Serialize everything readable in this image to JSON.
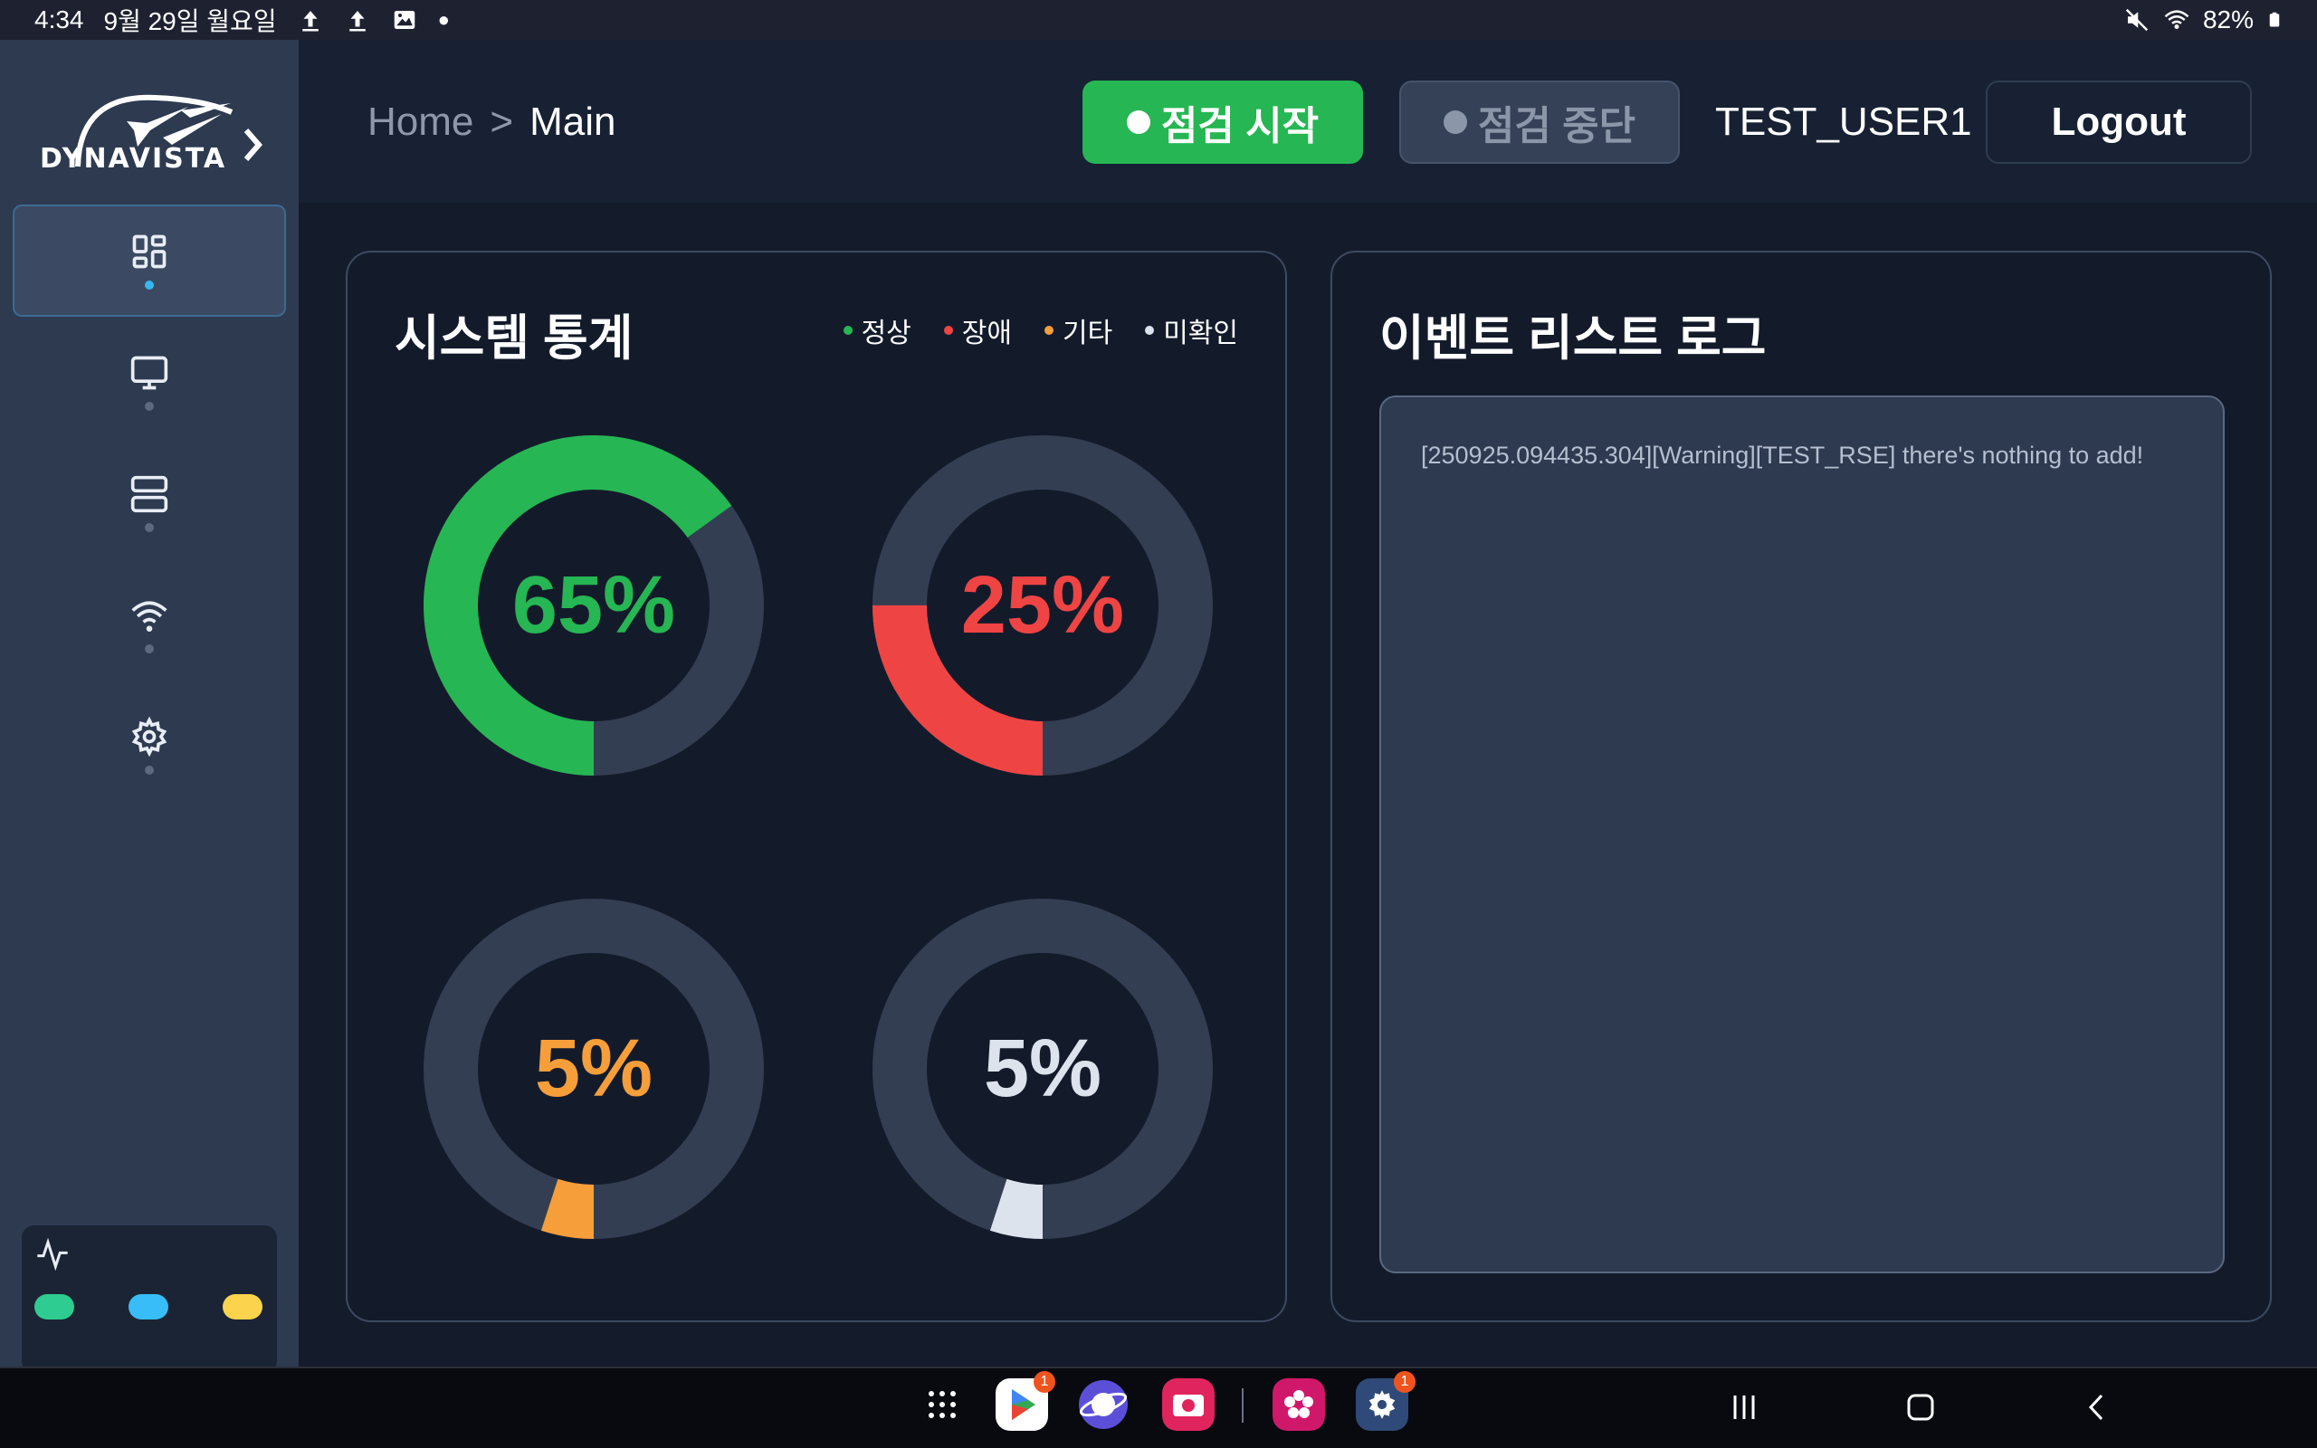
{
  "status_bar": {
    "time": "4:34",
    "date": "9월 29일 월요일",
    "battery": "82%",
    "icons": [
      "upload-icon",
      "upload-icon",
      "image-icon",
      "dot-icon",
      "mute-icon",
      "wifi-icon",
      "battery-icon"
    ]
  },
  "sidebar": {
    "logo_text": "DYNAVISTA",
    "nav": [
      {
        "icon": "dashboard-icon",
        "active": true
      },
      {
        "icon": "monitor-icon",
        "active": false
      },
      {
        "icon": "server-icon",
        "active": false
      },
      {
        "icon": "wifi-icon",
        "active": false
      },
      {
        "icon": "gear-icon",
        "active": false
      }
    ],
    "indicators": {
      "icon": "activity-icon",
      "colors": [
        "#2ecc90",
        "#38bdf8",
        "#fcd34d"
      ]
    }
  },
  "header": {
    "breadcrumb": {
      "home": "Home",
      "separator": ">",
      "current": "Main"
    },
    "start_label": "점검 시작",
    "stop_label": "점검 중단",
    "user": "TEST_USER1",
    "logout_label": "Logout"
  },
  "stats": {
    "title": "시스템 통계",
    "legend": [
      {
        "label": "정상",
        "color": "#26b653"
      },
      {
        "label": "장애",
        "color": "#ef4444"
      },
      {
        "label": "기타",
        "color": "#f59e3a"
      },
      {
        "label": "미확인",
        "color": "#dde3ec"
      }
    ],
    "donuts": [
      {
        "label": "65%",
        "value": 65,
        "color": "#26b653"
      },
      {
        "label": "25%",
        "value": 25,
        "color": "#ef4444"
      },
      {
        "label": "5%",
        "value": 5,
        "color": "#f59e3a"
      },
      {
        "label": "5%",
        "value": 5,
        "color": "#dde3ec"
      }
    ]
  },
  "events": {
    "title": "이벤트 리스트 로그",
    "lines": [
      "[250925.094435.304][Warning][TEST_RSE] there's nothing to add!"
    ]
  },
  "bottom_nav": {
    "apps": [
      {
        "icon": "app-grid-icon",
        "badge": ""
      },
      {
        "icon": "play-store-icon",
        "badge": "1"
      },
      {
        "icon": "internet-browser-icon",
        "badge": ""
      },
      {
        "icon": "camera-icon",
        "badge": ""
      },
      {
        "icon": "flower-app-icon",
        "badge": ""
      },
      {
        "icon": "settings-app-icon",
        "badge": "1"
      }
    ],
    "system": [
      "recent-apps-icon",
      "home-icon",
      "back-icon"
    ]
  }
}
